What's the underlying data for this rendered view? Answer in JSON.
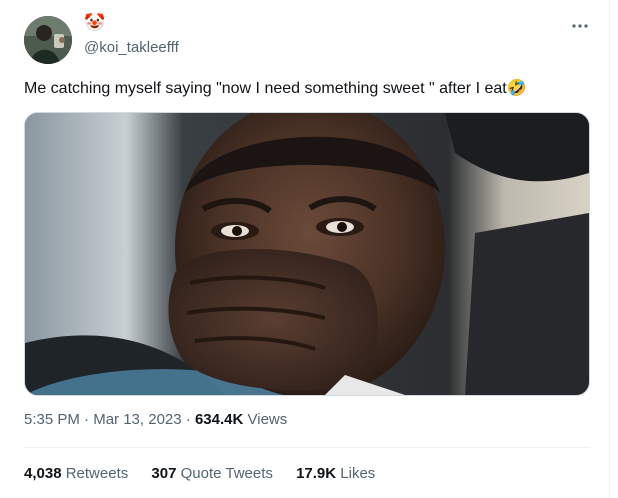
{
  "author": {
    "display_name_emoji": "🤡",
    "handle": "@koi_takleefff"
  },
  "more_icon": "more-horizontal-icon",
  "tweet": {
    "text": "Me catching myself saying \"now I need something sweet \" after I eat🤣"
  },
  "media": {
    "description_icon": "photo-icon"
  },
  "meta": {
    "time": "5:35 PM",
    "separator": "·",
    "date": "Mar 13, 2023",
    "views_count": "634.4K",
    "views_label": "Views"
  },
  "stats": {
    "retweets_count": "4,038",
    "retweets_label": "Retweets",
    "quotes_count": "307",
    "quotes_label": "Quote Tweets",
    "likes_count": "17.9K",
    "likes_label": "Likes"
  },
  "colors": {
    "primary_text": "#0f1419",
    "secondary_text": "#536471",
    "border": "#eff3f4"
  }
}
